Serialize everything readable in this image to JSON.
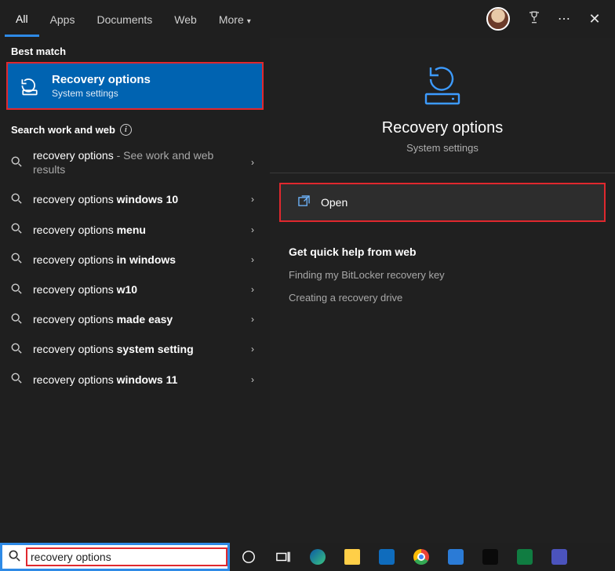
{
  "tabs": {
    "all": "All",
    "apps": "Apps",
    "documents": "Documents",
    "web": "Web",
    "more": "More"
  },
  "left": {
    "best_label": "Best match",
    "best_title": "Recovery options",
    "best_sub": "System settings",
    "sw_label": "Search work and web",
    "rows": [
      {
        "pre": "recovery options",
        "mid": " - ",
        "suf": "See work and web results"
      },
      {
        "pre": "recovery options ",
        "bold": "windows 10"
      },
      {
        "pre": "recovery options ",
        "bold": "menu"
      },
      {
        "pre": "recovery options ",
        "bold": "in windows"
      },
      {
        "pre": "recovery options ",
        "bold": "w10"
      },
      {
        "pre": "recovery options ",
        "bold": "made easy"
      },
      {
        "pre": "recovery options ",
        "bold": "system setting"
      },
      {
        "pre": "recovery options ",
        "bold": "windows 11"
      }
    ]
  },
  "right": {
    "title": "Recovery options",
    "sub": "System settings",
    "open": "Open",
    "help_header": "Get quick help from web",
    "help_links": [
      "Finding my BitLocker recovery key",
      "Creating a recovery drive"
    ]
  },
  "search_value": "recovery options"
}
